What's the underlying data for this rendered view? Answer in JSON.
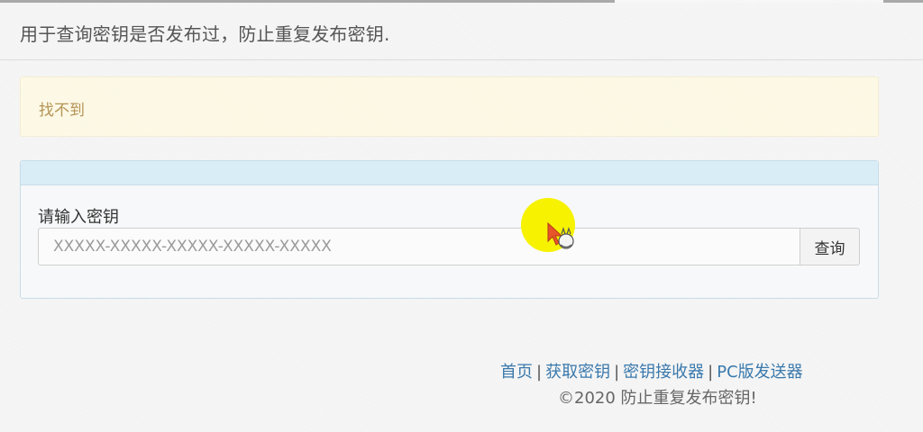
{
  "header": {
    "description": "用于查询密钥是否发布过，防止重复发布密钥."
  },
  "alert": {
    "message": "找不到"
  },
  "query_panel": {
    "input_label": "请输入密钥",
    "input_value": "",
    "input_placeholder": "XXXXX-XXXXX-XXXXX-XXXXX-XXXXX",
    "query_button_label": "查询"
  },
  "footer": {
    "links": [
      {
        "label": "首页"
      },
      {
        "label": "获取密钥"
      },
      {
        "label": "密钥接收器"
      },
      {
        "label": "PC版发送器"
      }
    ],
    "separator": "|",
    "copyright": "©2020 防止重复发布密钥!"
  },
  "colors": {
    "alert_background": "#fcf8e3",
    "alert_text": "#b49455",
    "panel_heading": "#d9edf7",
    "link": "#3a79ac",
    "cursor_highlight": "#f6f200"
  }
}
